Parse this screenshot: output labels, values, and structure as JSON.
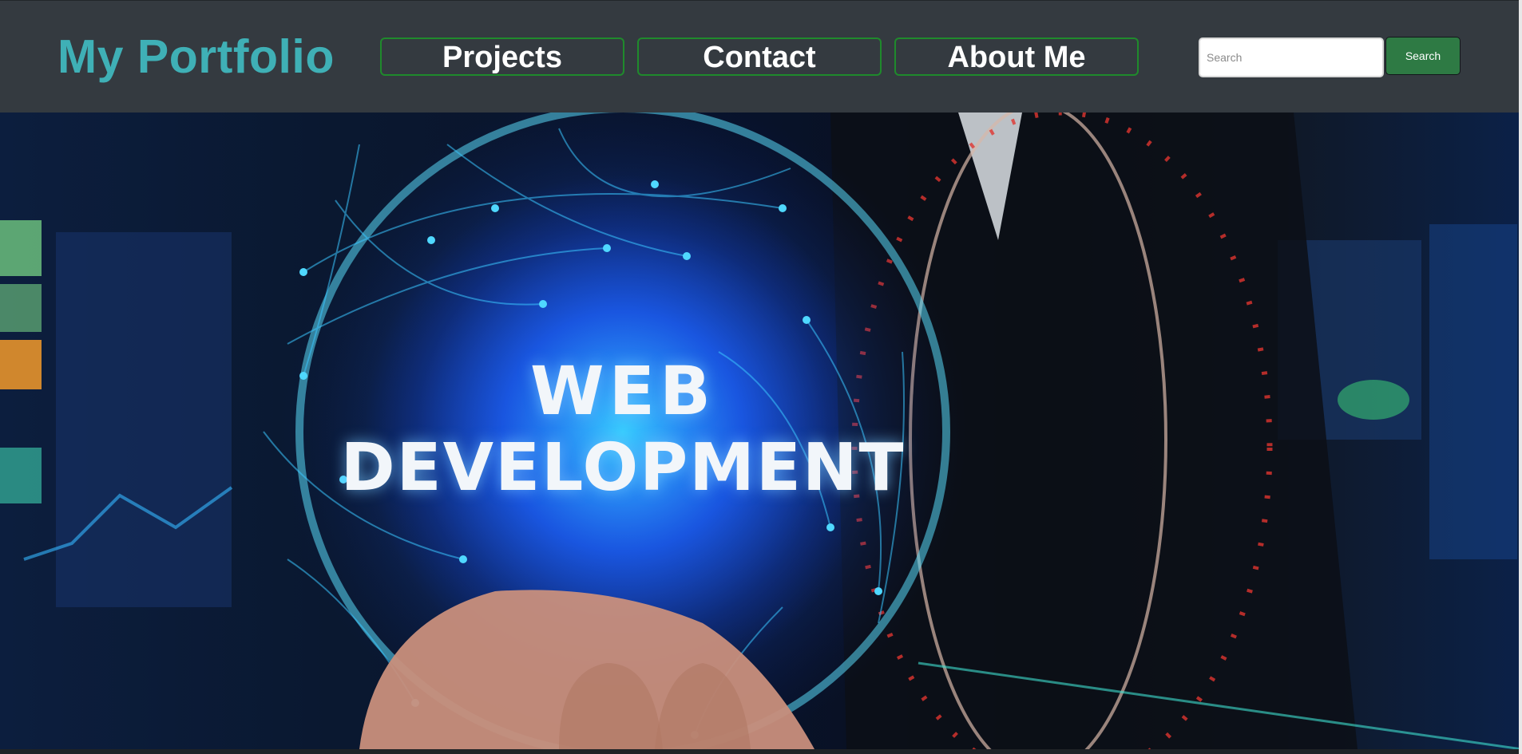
{
  "navbar": {
    "brand": "My Portfolio",
    "links": [
      {
        "label": "Projects"
      },
      {
        "label": "Contact"
      },
      {
        "label": "About Me"
      }
    ],
    "search": {
      "placeholder": "Search",
      "value": "",
      "button_label": "Search"
    }
  },
  "hero": {
    "line1": "WEB",
    "line2": "DEVELOPMENT"
  },
  "colors": {
    "navbar_bg": "#343a40",
    "brand": "#3fb0b6",
    "link_border": "#1f8a2c",
    "search_button_bg": "#2e7a44"
  }
}
